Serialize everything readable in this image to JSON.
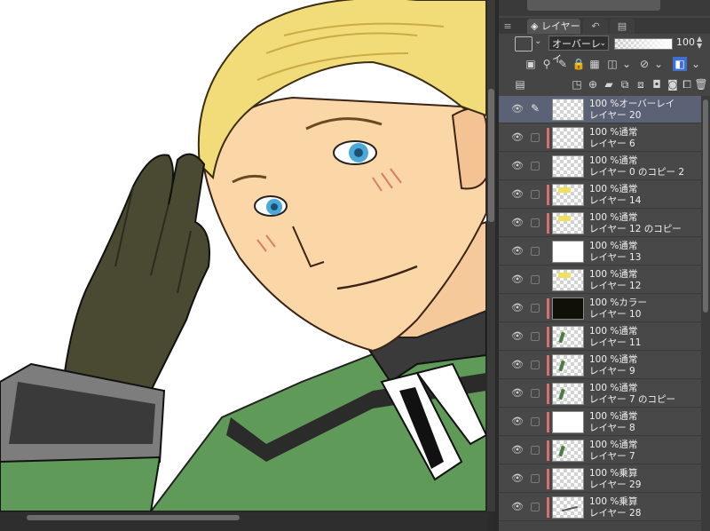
{
  "panel": {
    "tabs": {
      "layer": "レイヤー",
      "history": "↶",
      "navigator": "▤"
    },
    "blend_mode": "オーバーレイ",
    "opacity": "100"
  },
  "layers": [
    {
      "mode": "100 %オーバーレイ",
      "name": "レイヤー 20",
      "thumb": "checker",
      "selected": true,
      "pen": true,
      "marker": false
    },
    {
      "mode": "100 %通常",
      "name": "レイヤー 6",
      "thumb": "checker",
      "selected": false,
      "pen": false,
      "marker": true
    },
    {
      "mode": "100 %通常",
      "name": "レイヤー 0 のコピー 2",
      "thumb": "checker",
      "selected": false,
      "pen": false,
      "marker": false
    },
    {
      "mode": "100 %通常",
      "name": "レイヤー 14",
      "thumb": "yellow",
      "selected": false,
      "pen": false,
      "marker": true
    },
    {
      "mode": "100 %通常",
      "name": "レイヤー 12 のコピー",
      "thumb": "yellow",
      "selected": false,
      "pen": false,
      "marker": true
    },
    {
      "mode": "100 %通常",
      "name": "レイヤー 13",
      "thumb": "white",
      "selected": false,
      "pen": false,
      "marker": false
    },
    {
      "mode": "100 %通常",
      "name": "レイヤー 12",
      "thumb": "yellow",
      "selected": false,
      "pen": false,
      "marker": false
    },
    {
      "mode": "100 %カラー",
      "name": "レイヤー 10",
      "thumb": "dark",
      "selected": false,
      "pen": false,
      "marker": true
    },
    {
      "mode": "100 %通常",
      "name": "レイヤー 11",
      "thumb": "green",
      "selected": false,
      "pen": false,
      "marker": true
    },
    {
      "mode": "100 %通常",
      "name": "レイヤー 9",
      "thumb": "green",
      "selected": false,
      "pen": false,
      "marker": true
    },
    {
      "mode": "100 %通常",
      "name": "レイヤー 7 のコピー",
      "thumb": "green",
      "selected": false,
      "pen": false,
      "marker": true
    },
    {
      "mode": "100 %通常",
      "name": "レイヤー 8",
      "thumb": "white",
      "selected": false,
      "pen": false,
      "marker": true
    },
    {
      "mode": "100 %通常",
      "name": "レイヤー 7",
      "thumb": "green",
      "selected": false,
      "pen": false,
      "marker": true
    },
    {
      "mode": "100 %乗算",
      "name": "レイヤー 29",
      "thumb": "checker",
      "selected": false,
      "pen": false,
      "marker": true
    },
    {
      "mode": "100 %乗算",
      "name": "レイヤー 28",
      "thumb": "scribble",
      "selected": false,
      "pen": false,
      "marker": true
    }
  ],
  "colors": {
    "hair": "#f2dc7a",
    "skin": "#fbd7a8",
    "eyes": "#4aa9d8",
    "glove": "#4a4a32",
    "uniform": "#5f9a58",
    "layer_marker": "#d97070",
    "selected_row": "#5c6275"
  }
}
